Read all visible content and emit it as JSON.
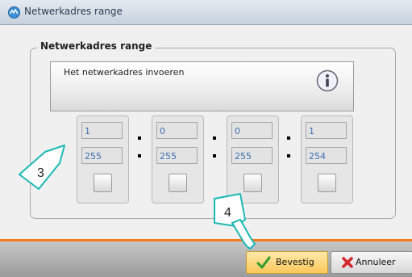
{
  "window": {
    "title": "Netwerkadres range",
    "app_icon": "app-icon"
  },
  "group": {
    "legend": "Netwerkadres range"
  },
  "info": {
    "text": "Het netwerkadres invoeren",
    "icon": "info-icon"
  },
  "octets": [
    {
      "start": "1",
      "end": "255"
    },
    {
      "start": "0",
      "end": "255"
    },
    {
      "start": "0",
      "end": "255"
    },
    {
      "start": "1",
      "end": "254"
    }
  ],
  "buttons": {
    "confirm_label": "Bevestig",
    "cancel_label": "Annuleer"
  },
  "callouts": {
    "step3": "3",
    "step4": "4"
  },
  "colors": {
    "accent": "#f07c22",
    "field_text": "#3b6fae",
    "callout": "#1ab9b4"
  }
}
